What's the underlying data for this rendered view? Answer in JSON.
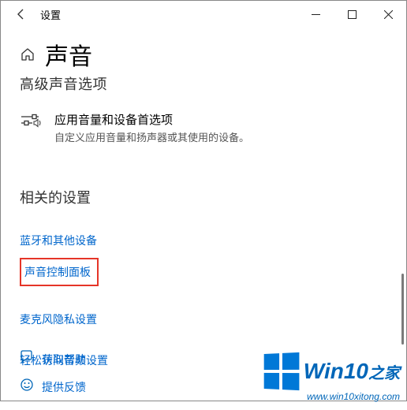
{
  "window": {
    "title": "设置"
  },
  "header": {
    "page_title": "声音",
    "subheading": "高级声音选项"
  },
  "option": {
    "title": "应用音量和设备首选项",
    "description": "自定义应用音量和扬声器或其使用的设备。"
  },
  "related": {
    "title": "相关的设置",
    "links": {
      "bluetooth": "蓝牙和其他设备",
      "sound_panel": "声音控制面板",
      "mic_privacy": "麦克风隐私设置",
      "ease_audio": "轻松访问音频设置"
    }
  },
  "footer": {
    "help": "获取帮助",
    "feedback": "提供反馈"
  },
  "watermark": {
    "brand_main": "Win10",
    "brand_suffix": "之家",
    "url": "www.win10xitong.com"
  }
}
